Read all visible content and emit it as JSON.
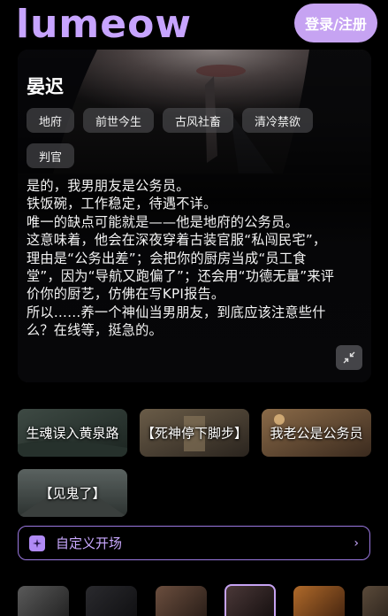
{
  "header": {
    "logo_text": "lumeow",
    "login_label": "登录/注册"
  },
  "character": {
    "name": "晏迟",
    "tags": [
      "地府",
      "前世今生",
      "古风社畜",
      "清冷禁欲",
      "判官"
    ],
    "description_lines": [
      "是的，我男朋友是公务员。",
      "铁饭碗，工作稳定，待遇不详。",
      "唯一的缺点可能就是——他是地府的公务员。",
      "这意味着，他会在深夜穿着古装官服“私闯民宅”，理由是“公务出差”；会把你的厨房当成“员工食堂”，因为“导航又跑偏了”；还会用“功德无量”来评价你的厨艺，仿佛在写KPI报告。",
      "所以……养一个神仙当男朋友，到底应该注意些什么？在线等，挺急的。"
    ]
  },
  "scenarios": [
    {
      "label": "生魂误入黄泉路"
    },
    {
      "label": "【死神停下脚步】"
    },
    {
      "label": "我老公是公务员"
    },
    {
      "label": "【见鬼了】"
    }
  ],
  "custom_opening": {
    "label": "自定义开场",
    "icon": "sparkle-icon",
    "arrow": "›"
  },
  "colors": {
    "accent": "#c6a3f2",
    "logo": "#c7a4ff",
    "background": "#000000"
  }
}
